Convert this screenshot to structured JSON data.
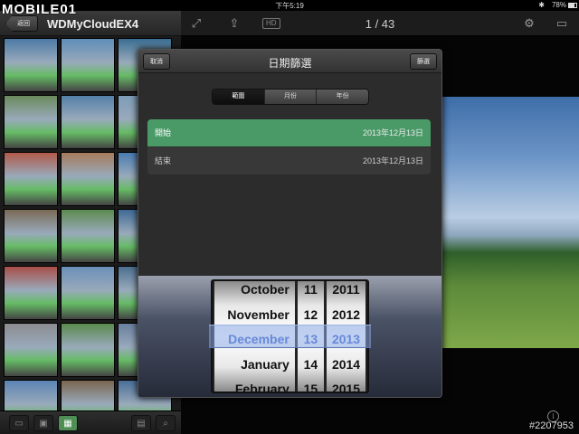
{
  "status_bar": {
    "time": "下午5:19",
    "battery": "78%",
    "bluetooth": "✱"
  },
  "watermark": {
    "logo": "MOBILE01",
    "photo_id": "#2207953"
  },
  "left_panel": {
    "back_label": "返回",
    "title": "WDMyCloudEX4",
    "thumbnails": [
      "#4d7aa6",
      "#5f8db8",
      "#3b6e93",
      "#6a8a5c",
      "#5480a8",
      "#7e9cb8",
      "#b05a4a",
      "#a67b5c",
      "#4a7cb2",
      "#7a6a55",
      "#5c8a4f",
      "#3f6a95",
      "#a84e48",
      "#6b8fb9",
      "#4d6f8f",
      "#8c8c90",
      "#5a8a4d",
      "#6a7fa0",
      "#5b84b4",
      "#7a6650",
      "#4a6e98"
    ],
    "bottom_icons": [
      "folder-icon",
      "single-view-icon",
      "grid-view-icon",
      "calendar-icon",
      "search-icon"
    ]
  },
  "right_panel": {
    "counter": "1 / 43",
    "hd_label": "HD",
    "icons": [
      "expand-icon",
      "share-icon",
      "gear-icon",
      "airplay-icon"
    ],
    "info_glyph": "i"
  },
  "dialog": {
    "title": "日期篩選",
    "cancel_label": "取消",
    "filter_label": "篩選",
    "segments": [
      "範圍",
      "月份",
      "年份"
    ],
    "active_segment": "範圍",
    "start": {
      "label": "開始",
      "value": "2013年12月13日"
    },
    "end": {
      "label": "結束",
      "value": "2013年12月13日"
    }
  },
  "picker": {
    "months": [
      "October",
      "November",
      "December",
      "January",
      "February"
    ],
    "days": [
      "11",
      "12",
      "13",
      "14",
      "15"
    ],
    "years": [
      "2011",
      "2012",
      "2013",
      "2014",
      "2015"
    ],
    "selected": {
      "month": "December",
      "day": "13",
      "year": "2013"
    }
  }
}
